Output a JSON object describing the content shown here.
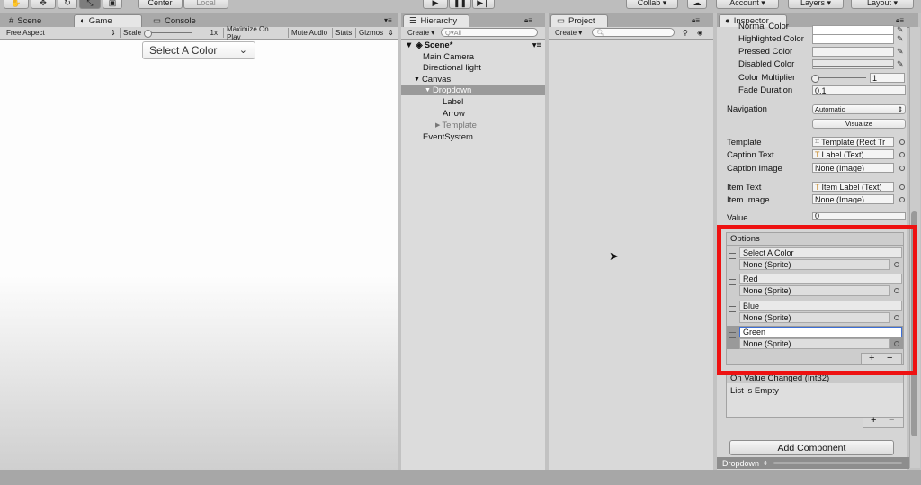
{
  "toolbar": {
    "pivot_center": "Center",
    "pivot_local": "Local",
    "collab": "Collab ▾",
    "account": "Account ▾",
    "layers": "Layers ▾",
    "layout": "Layout ▾"
  },
  "tabs": {
    "scene": "Scene",
    "game": "Game",
    "console": "Console",
    "hierarchy": "Hierarchy",
    "project": "Project",
    "inspector": "Inspector"
  },
  "game_bar": {
    "aspect": "Free Aspect",
    "scale_label": "Scale",
    "scale_value": "1x",
    "maximize": "Maximize On Play",
    "mute": "Mute Audio",
    "stats": "Stats",
    "gizmos": "Gizmos"
  },
  "game_view": {
    "dropdown_label": "Select A Color"
  },
  "hierarchy": {
    "create": "Create ▾",
    "search_placeholder": "Q▾All",
    "scene": "Scene*",
    "items": [
      "Main Camera",
      "Directional light",
      "Canvas",
      "Dropdown",
      "Label",
      "Arrow",
      "Template",
      "EventSystem"
    ]
  },
  "project": {
    "create": "Create ▾"
  },
  "inspector": {
    "normal_color": "Normal Color",
    "highlighted_color": "Highlighted Color",
    "pressed_color": "Pressed Color",
    "disabled_color": "Disabled Color",
    "color_multiplier": "Color Multiplier",
    "color_multiplier_value": "1",
    "fade_duration": "Fade Duration",
    "fade_duration_value": "0.1",
    "navigation": "Navigation",
    "navigation_value": "Automatic",
    "visualize": "Visualize",
    "template": "Template",
    "template_value": "Template (Rect Tr",
    "caption_text": "Caption Text",
    "caption_text_value": "Label (Text)",
    "caption_image": "Caption Image",
    "caption_image_value": "None (Image)",
    "item_text": "Item Text",
    "item_text_value": "Item Label (Text)",
    "item_image": "Item Image",
    "item_image_value": "None (Image)",
    "value": "Value",
    "value_value": "0",
    "options_header": "Options",
    "options": [
      {
        "text": "Select A Color",
        "sprite": "None (Sprite)"
      },
      {
        "text": "Red",
        "sprite": "None (Sprite)"
      },
      {
        "text": "Blue",
        "sprite": "None (Sprite)"
      },
      {
        "text": "Green",
        "sprite": "None (Sprite)"
      }
    ],
    "plus": "+",
    "minus": "−",
    "on_value_changed": "On Value Changed (Int32)",
    "list_empty": "List is Empty",
    "add_component": "Add Component",
    "footer": "Dropdown"
  },
  "colors": {
    "highlight_box": "#ee1111",
    "selected_row": "#9a9a9a"
  }
}
